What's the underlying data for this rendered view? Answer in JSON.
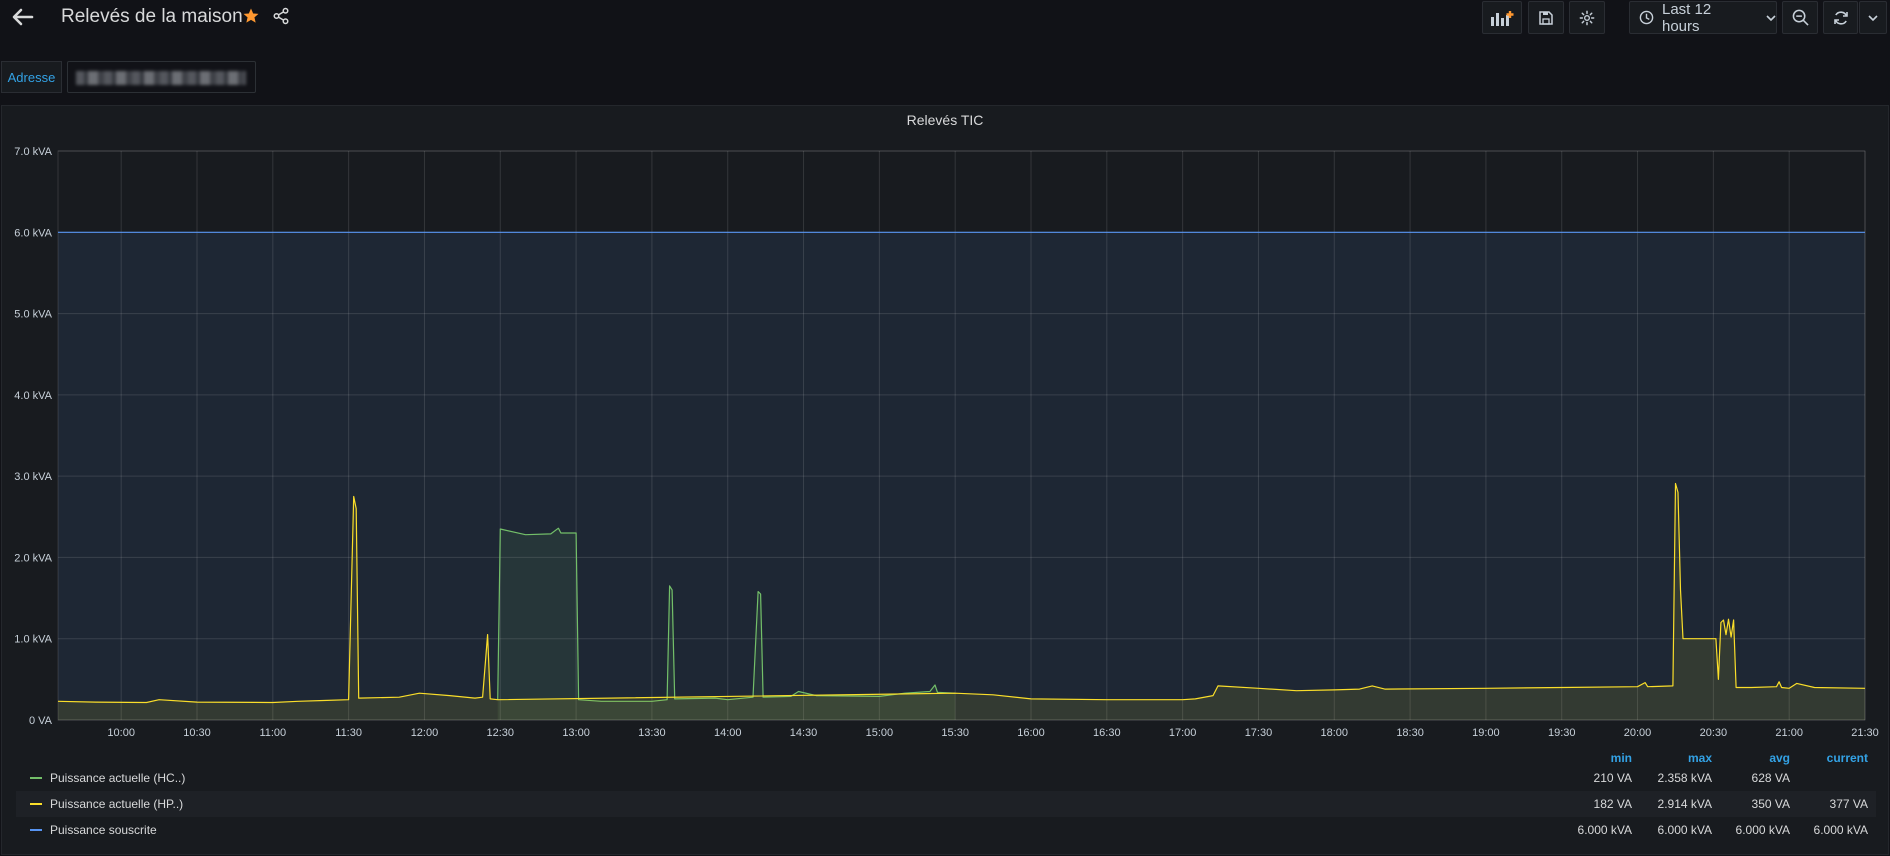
{
  "header": {
    "title": "Relevés de la maison",
    "time_range": "Last 12 hours",
    "icons": [
      "back-arrow-icon",
      "star-icon",
      "share-icon",
      "add-panel-icon",
      "save-icon",
      "gear-icon",
      "clock-icon",
      "chevron-down-icon",
      "zoom-out-icon",
      "refresh-icon"
    ]
  },
  "variables": {
    "address_label": "Adresse"
  },
  "panel": {
    "title": "Relevés TIC"
  },
  "colors": {
    "hc": "#73bf69",
    "hp": "#fade2a",
    "sub": "#5794f2",
    "accent": "#33a2e5",
    "star": "#ff9830"
  },
  "chart_data": {
    "type": "line",
    "xlabel": "",
    "ylabel": "",
    "ylim": [
      0,
      7000
    ],
    "xlim": [
      "09:35",
      "21:30"
    ],
    "y_ticks": [
      "0 VA",
      "1.0 kVA",
      "2.0 kVA",
      "3.0 kVA",
      "4.0 kVA",
      "5.0 kVA",
      "6.0 kVA",
      "7.0 kVA"
    ],
    "x_ticks": [
      "10:00",
      "10:30",
      "11:00",
      "11:30",
      "12:00",
      "12:30",
      "13:00",
      "13:30",
      "14:00",
      "14:30",
      "15:00",
      "15:30",
      "16:00",
      "16:30",
      "17:00",
      "17:30",
      "18:00",
      "18:30",
      "19:00",
      "19:30",
      "20:00",
      "20:30",
      "21:00",
      "21:30"
    ],
    "grid": true,
    "legend_position": "bottom",
    "series": [
      {
        "name": "Puissance actuelle (HC..)",
        "color": "#73bf69",
        "points": [
          [
            "12:29",
            250
          ],
          [
            "12:30",
            2350
          ],
          [
            "12:40",
            2280
          ],
          [
            "12:50",
            2290
          ],
          [
            "12:53",
            2360
          ],
          [
            "12:54",
            2300
          ],
          [
            "13:00",
            2300
          ],
          [
            "13:01",
            250
          ],
          [
            "13:10",
            230
          ],
          [
            "13:30",
            230
          ],
          [
            "13:36",
            250
          ],
          [
            "13:37",
            1650
          ],
          [
            "13:38",
            1600
          ],
          [
            "13:39",
            260
          ],
          [
            "13:55",
            270
          ],
          [
            "14:00",
            250
          ],
          [
            "14:10",
            280
          ],
          [
            "14:12",
            1580
          ],
          [
            "14:13",
            1550
          ],
          [
            "14:14",
            280
          ],
          [
            "14:25",
            290
          ],
          [
            "14:28",
            350
          ],
          [
            "14:35",
            300
          ],
          [
            "15:00",
            290
          ],
          [
            "15:10",
            330
          ],
          [
            "15:20",
            350
          ],
          [
            "15:22",
            430
          ],
          [
            "15:23",
            340
          ],
          [
            "15:30",
            330
          ]
        ]
      },
      {
        "name": "Puissance actuelle (HP..)",
        "color": "#fade2a",
        "points": [
          [
            "09:35",
            230
          ],
          [
            "09:50",
            220
          ],
          [
            "10:10",
            215
          ],
          [
            "10:15",
            250
          ],
          [
            "10:30",
            220
          ],
          [
            "11:00",
            215
          ],
          [
            "11:10",
            230
          ],
          [
            "11:20",
            240
          ],
          [
            "11:30",
            250
          ],
          [
            "11:32",
            2750
          ],
          [
            "11:33",
            2600
          ],
          [
            "11:34",
            270
          ],
          [
            "11:50",
            280
          ],
          [
            "11:58",
            330
          ],
          [
            "12:10",
            300
          ],
          [
            "12:20",
            270
          ],
          [
            "12:23",
            280
          ],
          [
            "12:25",
            1050
          ],
          [
            "12:26",
            260
          ],
          [
            "12:29",
            250
          ],
          [
            "15:30",
            330
          ],
          [
            "15:45",
            310
          ],
          [
            "16:00",
            260
          ],
          [
            "16:30",
            250
          ],
          [
            "17:00",
            250
          ],
          [
            "17:05",
            260
          ],
          [
            "17:12",
            300
          ],
          [
            "17:14",
            420
          ],
          [
            "17:30",
            390
          ],
          [
            "17:45",
            360
          ],
          [
            "18:00",
            370
          ],
          [
            "18:10",
            380
          ],
          [
            "18:15",
            420
          ],
          [
            "18:20",
            380
          ],
          [
            "19:00",
            390
          ],
          [
            "19:30",
            400
          ],
          [
            "20:00",
            410
          ],
          [
            "20:03",
            460
          ],
          [
            "20:04",
            410
          ],
          [
            "20:14",
            420
          ],
          [
            "20:15",
            2910
          ],
          [
            "20:16",
            2800
          ],
          [
            "20:17",
            1600
          ],
          [
            "20:18",
            1000
          ],
          [
            "20:28",
            1000
          ],
          [
            "20:31",
            1000
          ],
          [
            "20:32",
            500
          ],
          [
            "20:33",
            1200
          ],
          [
            "20:34",
            1230
          ],
          [
            "20:35",
            1050
          ],
          [
            "20:36",
            1240
          ],
          [
            "20:37",
            1020
          ],
          [
            "20:38",
            1230
          ],
          [
            "20:39",
            400
          ],
          [
            "20:45",
            400
          ],
          [
            "20:55",
            410
          ],
          [
            "20:56",
            470
          ],
          [
            "20:57",
            400
          ],
          [
            "21:00",
            390
          ],
          [
            "21:03",
            450
          ],
          [
            "21:10",
            400
          ],
          [
            "21:30",
            390
          ]
        ]
      },
      {
        "name": "Puissance souscrite",
        "color": "#5794f2",
        "points": [
          [
            "09:35",
            6000
          ],
          [
            "21:30",
            6000
          ]
        ]
      }
    ]
  },
  "legend": {
    "columns": [
      "min",
      "max",
      "avg",
      "current"
    ],
    "rows": [
      {
        "name": "Puissance actuelle (HC..)",
        "min": "210 VA",
        "max": "2.358 kVA",
        "avg": "628 VA",
        "current": ""
      },
      {
        "name": "Puissance actuelle (HP..)",
        "min": "182 VA",
        "max": "2.914 kVA",
        "avg": "350 VA",
        "current": "377 VA"
      },
      {
        "name": "Puissance souscrite",
        "min": "6.000 kVA",
        "max": "6.000 kVA",
        "avg": "6.000 kVA",
        "current": "6.000 kVA"
      }
    ]
  }
}
